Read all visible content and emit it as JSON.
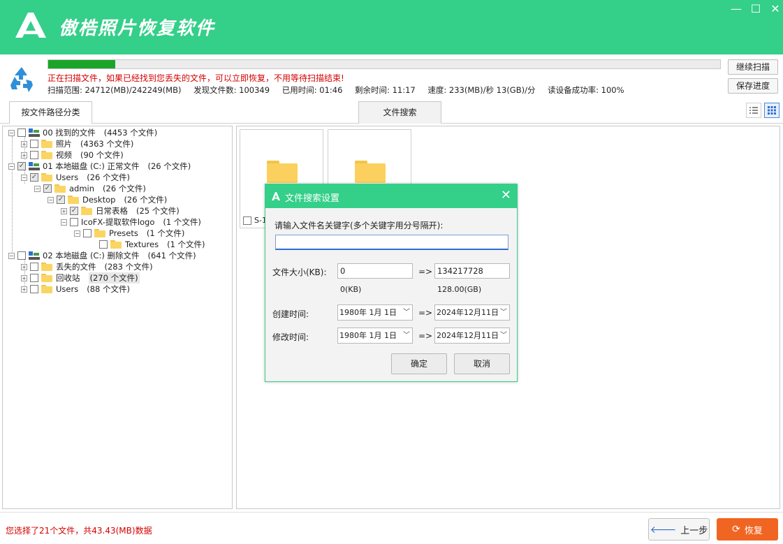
{
  "app": {
    "title": "傲梏照片恢复软件",
    "brand_color": "#34cf89"
  },
  "window_controls": {
    "minimize": "—",
    "maximize": "☐",
    "close": "✕"
  },
  "scan": {
    "progress_percent": 10,
    "message": "正在扫描文件，如果已经找到您丢失的文件，可以立即恢复，不用等待扫描结束!",
    "range": "扫描范围: 24712(MB)/242249(MB)",
    "found": "发现文件数: 100349",
    "elapsed": "已用时间: 01:46",
    "remaining": "剩余时间: 11:17",
    "speed": "速度: 233(MB)/秒  13(GB)/分",
    "success": "读设备成功率: 100%"
  },
  "side_buttons": {
    "continue": "继续扫描",
    "save": "保存进度"
  },
  "tabs": {
    "path": "按文件路径分类",
    "search": "文件搜索"
  },
  "tree": [
    {
      "label": "00 找到的文件",
      "count": "(4453 个文件)"
    },
    {
      "label": "照片",
      "count": "(4363 个文件)"
    },
    {
      "label": "视频",
      "count": "(90 个文件)"
    },
    {
      "label": "01 本地磁盘 (C:) 正常文件",
      "count": "(26 个文件)"
    },
    {
      "label": "Users",
      "count": "(26 个文件)"
    },
    {
      "label": "admin",
      "count": "(26 个文件)"
    },
    {
      "label": "Desktop",
      "count": "(26 个文件)"
    },
    {
      "label": "日常表格",
      "count": "(25 个文件)"
    },
    {
      "label": "IcoFX-提取软件logo",
      "count": "(1 个文件)"
    },
    {
      "label": "Presets",
      "count": "(1 个文件)"
    },
    {
      "label": "Textures",
      "count": "(1 个文件)"
    },
    {
      "label": "02 本地磁盘 (C:) 删除文件",
      "count": "(641 个文件)"
    },
    {
      "label": "丢失的文件",
      "count": "(283 个文件)"
    },
    {
      "label": "回收站",
      "count": "(270 个文件)"
    },
    {
      "label": "Users",
      "count": "(88 个文件)"
    }
  ],
  "cards": [
    {
      "caption": "S-1"
    },
    {
      "caption": ""
    }
  ],
  "dialog": {
    "title": "文件搜索设置",
    "keyword_prompt": "请输入文件名关键字(多个关键字用分号隔开):",
    "keyword_value": "",
    "size_label": "文件大小(KB):",
    "size_min": "0",
    "size_max": "134217728",
    "arrow": "=>",
    "size_min_hint": "0(KB)",
    "size_max_hint": "128.00(GB)",
    "created_label": "创建时间:",
    "created_from": "1980年  1月  1日",
    "created_to": "2024年12月11日",
    "modified_label": "修改时间:",
    "modified_from": "1980年  1月  1日",
    "modified_to": "2024年12月11日",
    "ok": "确定",
    "cancel": "取消"
  },
  "status": {
    "message": "您选择了21个文件，共43.43(MB)数据"
  },
  "nav": {
    "back": "上一步",
    "recover": "恢复",
    "recover_color": "#f16522"
  }
}
